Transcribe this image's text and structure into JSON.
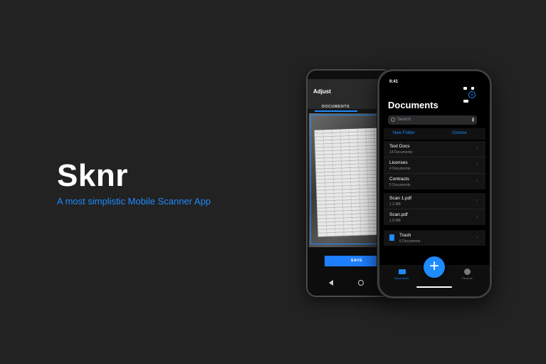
{
  "hero": {
    "title": "Sknr",
    "subtitle": "A most simplistic Mobile Scanner App"
  },
  "android": {
    "header_title": "Adjust",
    "tab_label": "DOCUMENTS",
    "save_label": "SAVE",
    "nav_icons": [
      "back-triangle",
      "home-circle"
    ]
  },
  "iphone": {
    "time": "9:41",
    "title": "Documents",
    "search_placeholder": "Search",
    "actions": {
      "new_folder": "New Folder",
      "choose": "Choose"
    },
    "folders": [
      {
        "name": "Text Docs",
        "meta": "14 Documents"
      },
      {
        "name": "Licenses",
        "meta": "4 Documents"
      },
      {
        "name": "Contracts",
        "meta": "5 Documents"
      }
    ],
    "files": [
      {
        "name": "Scan 1.pdf",
        "meta": "1.2 MB"
      },
      {
        "name": "Scan.pdf",
        "meta": "1.8 MB"
      }
    ],
    "trash": {
      "name": "Trash",
      "meta": "6 Documents"
    },
    "tabs": {
      "documents": "Documents",
      "recents": "Recents"
    },
    "fab_label": "+"
  },
  "colors": {
    "accent": "#1e8bff",
    "background": "#222222"
  }
}
